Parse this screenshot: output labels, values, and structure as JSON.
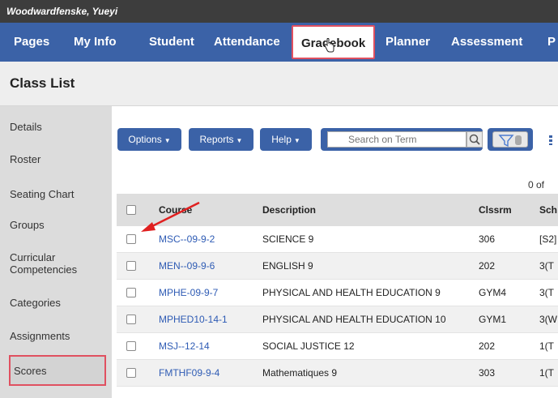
{
  "user": {
    "name": "Woodwardfenske, Yueyi"
  },
  "topnav": {
    "tabs": [
      {
        "label": "Pages"
      },
      {
        "label": "My Info"
      },
      {
        "label": "Student"
      },
      {
        "label": "Attendance"
      },
      {
        "label": "Gradebook",
        "active": true
      },
      {
        "label": "Planner"
      },
      {
        "label": "Assessment"
      },
      {
        "label": "P"
      }
    ]
  },
  "page": {
    "title": "Class List"
  },
  "sidebar": {
    "items": [
      {
        "label": "Details"
      },
      {
        "label": "Roster"
      },
      {
        "label": "Seating Chart"
      },
      {
        "label": "Groups"
      },
      {
        "label": "Curricular Competencies"
      },
      {
        "label": "Categories"
      },
      {
        "label": "Assignments"
      },
      {
        "label": "Scores"
      }
    ]
  },
  "toolbar": {
    "options_label": "Options",
    "reports_label": "Reports",
    "help_label": "Help",
    "search_placeholder": "Search on Term"
  },
  "results": {
    "count_text": "0 of"
  },
  "table": {
    "columns": [
      "Course",
      "Description",
      "Clssrm",
      "Sch"
    ],
    "rows": [
      {
        "course": "MSC--09-9-2",
        "description": "SCIENCE 9",
        "room": "306",
        "schedule": "[S2]"
      },
      {
        "course": "MEN--09-9-6",
        "description": "ENGLISH 9",
        "room": "202",
        "schedule": "3(T"
      },
      {
        "course": "MPHE-09-9-7",
        "description": "PHYSICAL AND HEALTH EDUCATION 9",
        "room": "GYM4",
        "schedule": "3(T"
      },
      {
        "course": "MPHED10-14-1",
        "description": "PHYSICAL AND HEALTH EDUCATION 10",
        "room": "GYM1",
        "schedule": "3(W"
      },
      {
        "course": "MSJ--12-14",
        "description": "SOCIAL JUSTICE 12",
        "room": "202",
        "schedule": "1(T"
      },
      {
        "course": "FMTHF09-9-4",
        "description": "Mathematiques 9",
        "room": "303",
        "schedule": "1(T"
      }
    ]
  },
  "colors": {
    "nav_blue": "#3b62a7",
    "highlight_red": "#e05060",
    "link_blue": "#2e5bb4"
  },
  "icons": [
    "hand-cursor-icon",
    "search-icon",
    "filter-icon",
    "caret-down-icon",
    "red-arrow-icon"
  ]
}
